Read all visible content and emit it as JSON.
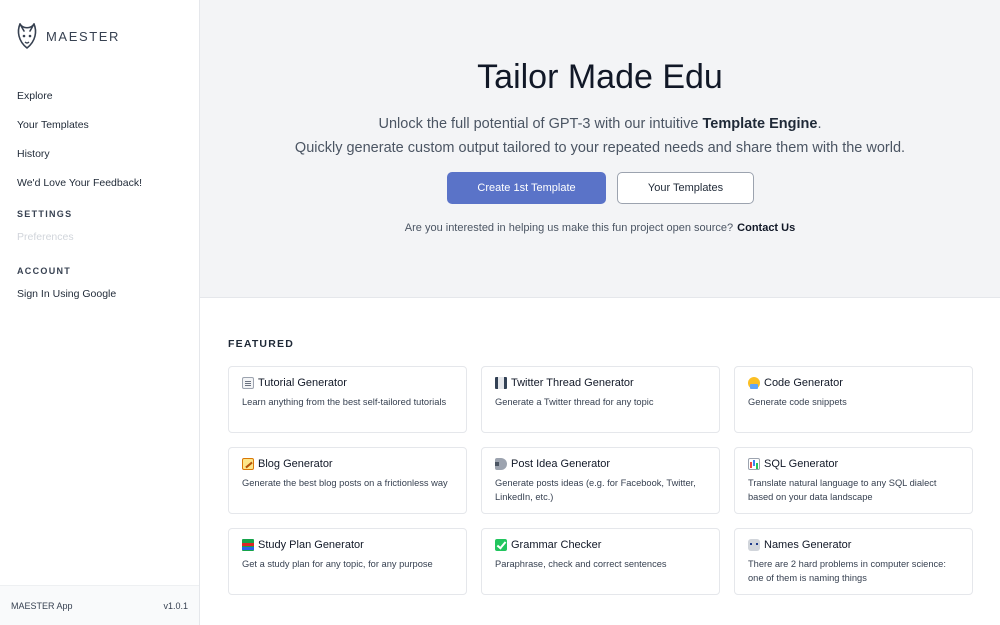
{
  "brand": {
    "name": "MAESTER"
  },
  "sidebar": {
    "nav": [
      {
        "label": "Explore"
      },
      {
        "label": "Your Templates"
      },
      {
        "label": "History"
      },
      {
        "label": "We'd Love Your Feedback!"
      }
    ],
    "settings_label": "SETTINGS",
    "preferences_label": "Preferences",
    "account_label": "ACCOUNT",
    "signin_label": "Sign In Using Google",
    "footer": {
      "app_name": "MAESTER App",
      "version": "v1.0.1"
    }
  },
  "hero": {
    "title": "Tailor Made Edu",
    "subtitle_pre": "Unlock the full potential of GPT-3 with our intuitive ",
    "subtitle_bold": "Template Engine",
    "subtitle_post": ".",
    "subtitle_line2": "Quickly generate custom output tailored to your repeated needs and share them with the world.",
    "primary_button": "Create 1st Template",
    "secondary_button": "Your Templates",
    "cta_text": "Are you interested in helping us make this fun project open source?",
    "cta_link": "Contact Us"
  },
  "featured": {
    "label": "FEATURED",
    "cards": [
      {
        "icon": "page-icon",
        "title": "Tutorial Generator",
        "desc": "Learn anything from the best self-tailored tutorials"
      },
      {
        "icon": "scroll-icon",
        "title": "Twitter Thread Generator",
        "desc": "Generate a Twitter thread for any topic"
      },
      {
        "icon": "technologist-icon",
        "title": "Code Generator",
        "desc": "Generate code snippets"
      },
      {
        "icon": "memo-icon",
        "title": "Blog Generator",
        "desc": "Generate the best blog posts on a frictionless way"
      },
      {
        "icon": "megaphone-icon",
        "title": "Post Idea Generator",
        "desc": "Generate posts ideas (e.g. for Facebook, Twitter, LinkedIn, etc.)"
      },
      {
        "icon": "bar-chart-icon",
        "title": "SQL Generator",
        "desc": "Translate natural language to any SQL dialect based on your data landscape"
      },
      {
        "icon": "books-icon",
        "title": "Study Plan Generator",
        "desc": "Get a study plan for any topic, for any purpose"
      },
      {
        "icon": "check-mark-icon",
        "title": "Grammar Checker",
        "desc": "Paraphrase, check and correct sentences"
      },
      {
        "icon": "robot-icon",
        "title": "Names Generator",
        "desc": "There are 2 hard problems in computer science: one of them is naming things"
      }
    ]
  },
  "colors": {
    "primary": "#5a73c8",
    "hero_bg": "#f3f4f6"
  }
}
